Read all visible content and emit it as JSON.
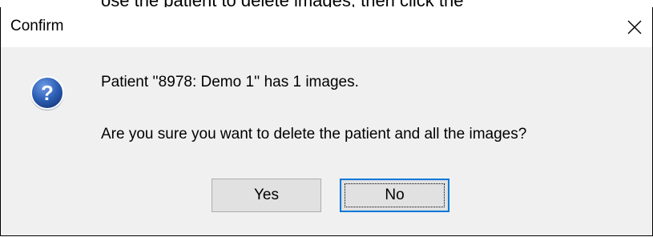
{
  "background_text": "ose the patient to delete images, then click the",
  "dialog": {
    "title": "Confirm",
    "message_line1": "Patient ''8978: Demo 1'' has 1 images.",
    "message_line2": "Are you sure you want to delete the patient and all the images?",
    "buttons": {
      "yes_label": "Yes",
      "no_label": "No"
    },
    "icon": "question-icon",
    "close_icon": "close-icon"
  },
  "colors": {
    "dialog_body": "#f0f0f0",
    "titlebar": "#ffffff",
    "button_face": "#e1e1e1",
    "focus_border": "#0078d7",
    "icon_blue": "#2a5db0"
  }
}
